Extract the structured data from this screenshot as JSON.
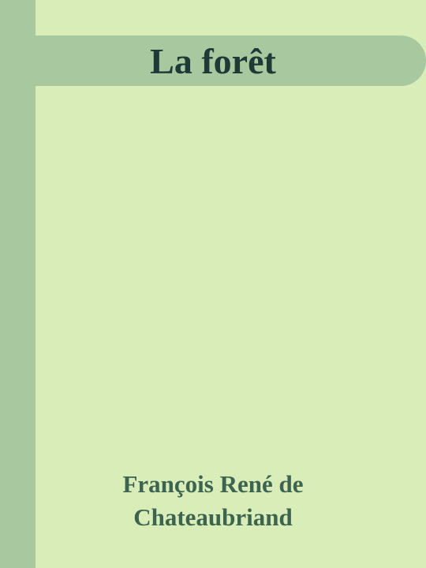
{
  "cover": {
    "title": "La forêt",
    "author_line1": "François René de",
    "author_line2": "Chateaubriand",
    "colors": {
      "background": "#d8edb8",
      "spine": "#a8c8a0",
      "title_band": "#a8c8a0",
      "title_text": "#1e3a36",
      "author_text": "#3d6450"
    }
  }
}
